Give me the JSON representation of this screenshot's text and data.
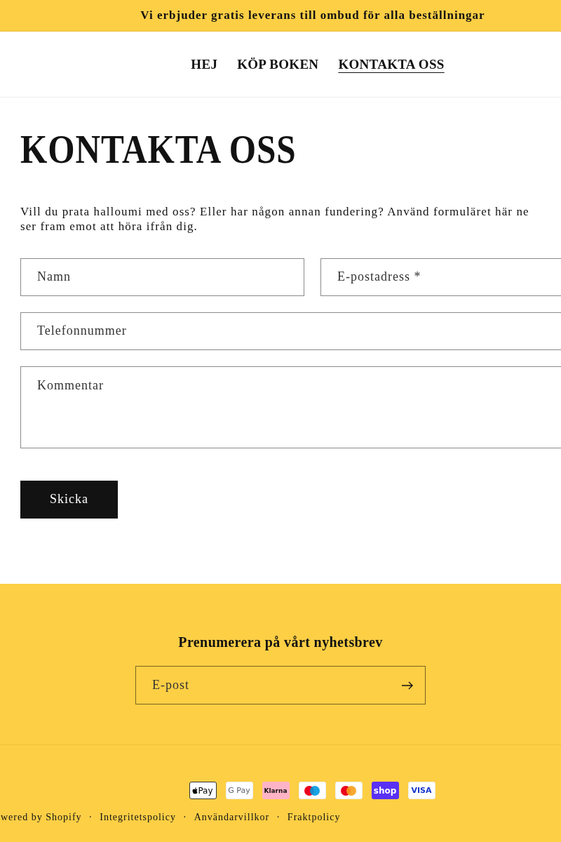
{
  "announcement": "Vi erbjuder gratis leverans till ombud för alla beställningar",
  "nav": [
    {
      "label": "HEJ",
      "selected": false
    },
    {
      "label": "KÖP BOKEN",
      "selected": false
    },
    {
      "label": "KONTAKTA OSS",
      "selected": true
    }
  ],
  "heading": "KONTAKTA OSS",
  "intro_lines": [
    "Vill du prata halloumi med oss? Eller har någon annan fundering? Använd formuläret här ne",
    "ser fram emot att höra ifrån dig."
  ],
  "form": {
    "fields": [
      {
        "placeholder": "Namn",
        "kind": "half"
      },
      {
        "placeholder": "E-postadress *",
        "kind": "half"
      },
      {
        "placeholder": "Telefonnummer",
        "kind": "full"
      },
      {
        "placeholder": "Kommentar",
        "kind": "area"
      }
    ],
    "submit": "Skicka"
  },
  "newsletter": {
    "title": "Prenumerera på vårt nyhetsbrev",
    "placeholder": "E-post"
  },
  "payments": [
    {
      "kind": "apple",
      "label": "Pay"
    },
    {
      "kind": "google",
      "label": "G Pay"
    },
    {
      "kind": "klarna",
      "label": "Klarna"
    },
    {
      "kind": "maestro"
    },
    {
      "kind": "mastercard"
    },
    {
      "kind": "shop",
      "label": "shop"
    },
    {
      "kind": "visa",
      "label": "VISA"
    }
  ],
  "footer_links": [
    "wered by Shopify",
    "Integritetspolicy",
    "Användarvillkor",
    "Fraktpolicy"
  ],
  "separator": "·"
}
